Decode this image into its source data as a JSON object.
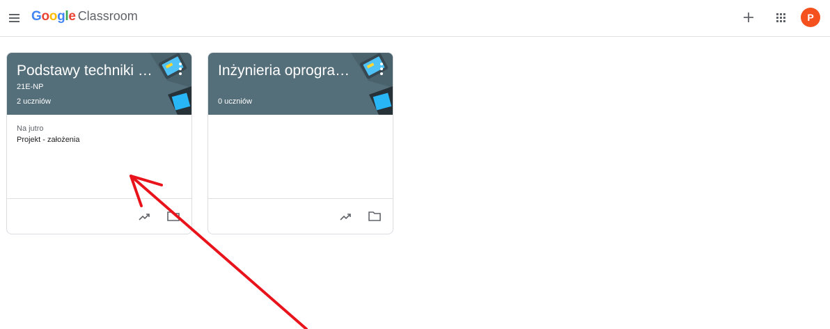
{
  "app": {
    "brand_letters": [
      "G",
      "o",
      "o",
      "g",
      "l",
      "e"
    ],
    "product": "Classroom"
  },
  "header": {
    "menu_icon": "hamburger-menu-icon",
    "create_icon": "plus-icon",
    "apps_icon": "apps-grid-icon",
    "avatar_initial": "P",
    "avatar_color": "#f4511e"
  },
  "colors": {
    "card_header": "#546e7a",
    "annotation_arrow": "#e8131b"
  },
  "cards": [
    {
      "title": "Podstawy techniki mi...",
      "section": "21E-NP",
      "students": "2 uczniów",
      "due_label": "Na jutro",
      "due_item": "Projekt - założenia"
    },
    {
      "title": "Inżynieria oprogramo...",
      "section": "",
      "students": "0 uczniów",
      "due_label": "",
      "due_item": ""
    }
  ]
}
